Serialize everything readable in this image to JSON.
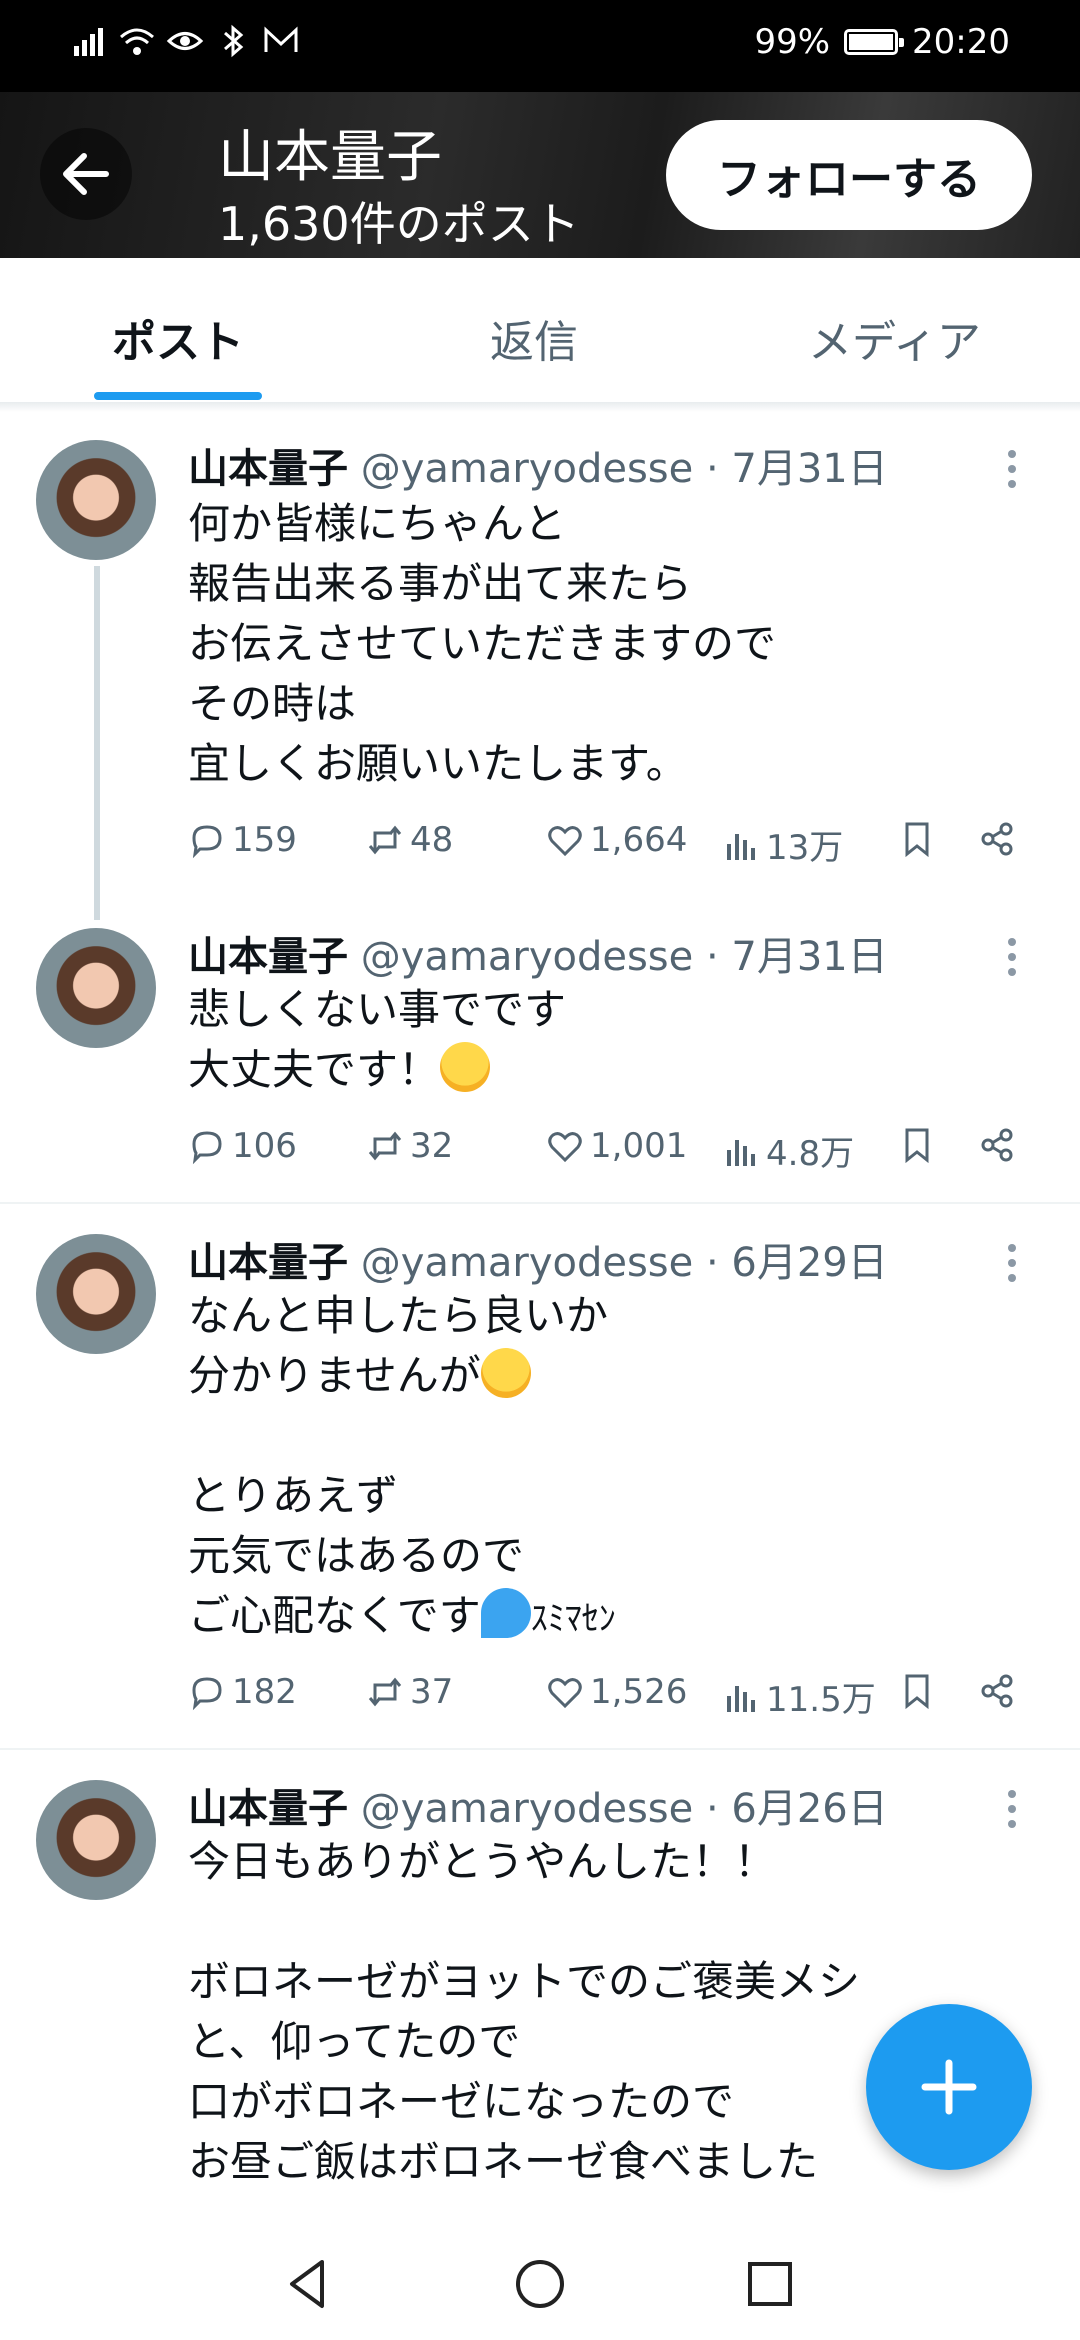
{
  "status_bar": {
    "battery": "99%",
    "battery_level": 0.99,
    "time": "20:20",
    "icons": [
      "signal-icon",
      "wifi-icon",
      "eye-icon",
      "bluetooth-icon",
      "mail-icon"
    ]
  },
  "header": {
    "title": "山本量子",
    "post_count": "1,630件のポスト",
    "follow_label": "フォローする"
  },
  "tabs": [
    {
      "label": "ポスト",
      "active": true
    },
    {
      "label": "返信",
      "active": false
    },
    {
      "label": "メディア",
      "active": false
    }
  ],
  "tweets": [
    {
      "name": "山本量子",
      "handle": "@yamaryodesse · 7月31日",
      "text": "何か皆様にちゃんと\n報告出来る事が出て来たら\nお伝えさせていただきますので\nその時は\n宜しくお願いいたします。",
      "replies": "159",
      "retweets": "48",
      "likes": "1,664",
      "views": "13万"
    },
    {
      "name": "山本量子",
      "handle": "@yamaryodesse · 7月31日",
      "text_lines": [
        "悲しくない事でです",
        "大丈夫です！"
      ],
      "replies": "106",
      "retweets": "32",
      "likes": "1,001",
      "views": "4.8万"
    },
    {
      "name": "山本量子",
      "handle": "@yamaryodesse · 6月29日",
      "text_lines": [
        "なんと申したら良いか",
        "分かりませんが",
        "",
        "とりあえず",
        "元気ではあるので",
        "ご心配なくです",
        "ｽﾐﾏｾﾝ"
      ],
      "replies": "182",
      "retweets": "37",
      "likes": "1,526",
      "views": "11.5万"
    },
    {
      "name": "山本量子",
      "handle": "@yamaryodesse · 6月26日",
      "text": "今日もありがとうやんした！！\n\nボロネーゼがヨットでのご褒美メシ\nと、仰ってたので\n口がボロネーゼになったので\nお昼ご飯はボロネーゼ食べました"
    }
  ],
  "colors": {
    "accent": "#1d9bf0",
    "muted": "#536471",
    "text": "#0f1419"
  }
}
